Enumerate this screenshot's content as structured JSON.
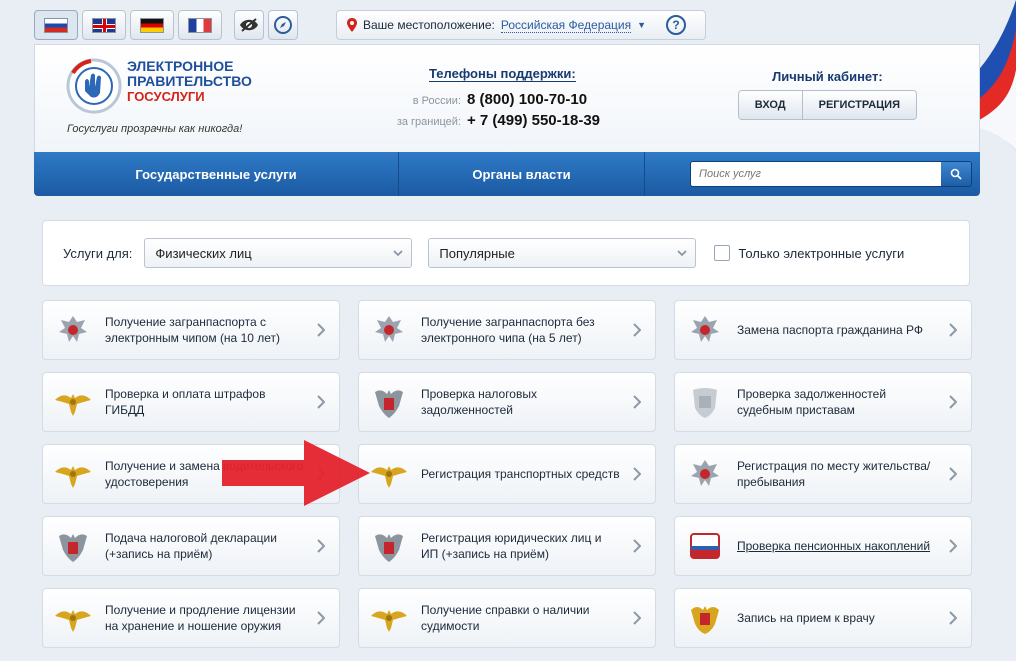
{
  "lang": {
    "items": [
      {
        "code": "ru"
      },
      {
        "code": "gb"
      },
      {
        "code": "de"
      },
      {
        "code": "fr"
      }
    ]
  },
  "tools": [
    {
      "icon": "eye-icon"
    },
    {
      "icon": "compass-icon"
    }
  ],
  "location": {
    "label": "Ваше местоположение:",
    "value": "Российская Федерация",
    "help": "?"
  },
  "header": {
    "logo_line1": "ЭЛЕКТРОННОЕ",
    "logo_line2": "ПРАВИТЕЛЬСТВО",
    "logo_line3": "ГОСУСЛУГИ",
    "slogan": "Госуслуги прозрачны как никогда!"
  },
  "support": {
    "title": "Телефоны поддержки:",
    "russia_label": "в России:",
    "russia_phone": "8 (800) 100-70-10",
    "abroad_label": "за границей:",
    "abroad_phone": "+ 7 (499) 550-18-39"
  },
  "cabinet": {
    "title": "Личный кабинет:",
    "login": "ВХОД",
    "register": "РЕГИСТРАЦИЯ"
  },
  "nav": {
    "tab1": "Государственные услуги",
    "tab2": "Органы власти",
    "search_placeholder": "Поиск услуг"
  },
  "filters": {
    "label": "Услуги для:",
    "who": "Физических лиц",
    "popular": "Популярные",
    "only_electronic": "Только электронные услуги"
  },
  "services": [
    {
      "label": "Получение загранпаспорта с электронным чипом (на 10 лет)",
      "icon": "fms-emblem-icon"
    },
    {
      "label": "Получение загранпаспорта без электронного чипа (на 5 лет)",
      "icon": "fms-emblem-icon"
    },
    {
      "label": "Замена паспорта гражданина РФ",
      "icon": "fms-emblem-icon"
    },
    {
      "label": "Проверка и оплата штрафов ГИБДД",
      "icon": "mvd-emblem-icon"
    },
    {
      "label": "Проверка налоговых задолженностей",
      "icon": "tax-emblem-icon"
    },
    {
      "label": "Проверка задолженностей судебным приставам",
      "icon": "bailiff-emblem-icon"
    },
    {
      "label": "Получение и замена водительского удостоверения",
      "icon": "mvd-emblem-icon"
    },
    {
      "label": "Регистрация транспортных средств",
      "icon": "mvd-emblem-icon"
    },
    {
      "label": "Регистрация по месту жительства/пребывания",
      "icon": "fms-emblem-icon"
    },
    {
      "label": "Подача налоговой декларации (+запись на приём)",
      "icon": "tax-emblem-icon"
    },
    {
      "label": "Регистрация юридических лиц и ИП (+запись на приём)",
      "icon": "tax-emblem-icon"
    },
    {
      "label": "Проверка пенсионных накоплений",
      "icon": "pension-fund-icon"
    },
    {
      "label": "Получение и продление лицензии на хранение и ношение оружия",
      "icon": "mvd-emblem-icon"
    },
    {
      "label": "Получение справки о наличии судимости",
      "icon": "mvd-emblem-icon"
    },
    {
      "label": "Запись на прием к врачу",
      "icon": "coat-of-arms-icon"
    }
  ],
  "colors": {
    "nav_blue": "#1b5aa3",
    "link_blue": "#2b5c9e",
    "arrow_red": "#e3222c"
  }
}
